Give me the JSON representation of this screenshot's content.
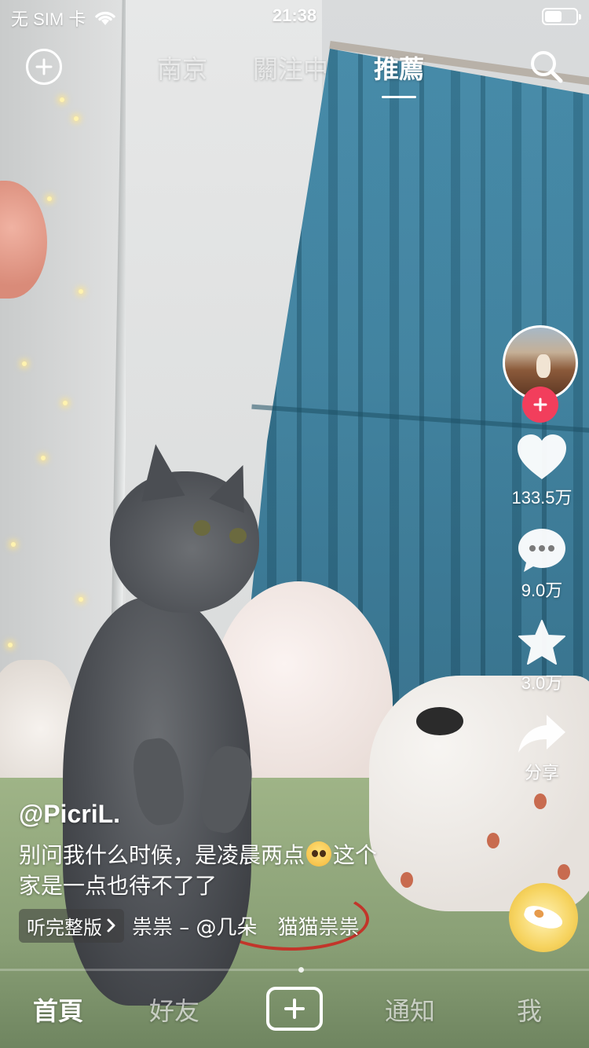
{
  "status_bar": {
    "carrier": "无 SIM 卡",
    "time": "21:38",
    "battery_level": 0.55
  },
  "top_nav": {
    "tabs": [
      {
        "label": "南京",
        "active": false
      },
      {
        "label": "關注中",
        "active": false
      },
      {
        "label": "推薦",
        "active": true
      }
    ]
  },
  "right_rail": {
    "likes": "133.5万",
    "comments": "9.0万",
    "favorites": "3.0万",
    "share": "分享"
  },
  "post": {
    "username": "@PicriL.",
    "description_line1_a": "别问我什么时候，是凌晨两点",
    "description_line1_b": "这个",
    "description_line2": "家是一点也待不了了",
    "full_version": "听完整版",
    "music": "祟祟 – @几朵　猫猫祟祟",
    "emoji": "pleading-face"
  },
  "playback": {
    "progress": 0.51
  },
  "bottom_nav": {
    "home": "首頁",
    "friends": "好友",
    "inbox": "通知",
    "me": "我"
  },
  "colors": {
    "follow_accent": "#f23e5c",
    "text": "#ffffff"
  }
}
